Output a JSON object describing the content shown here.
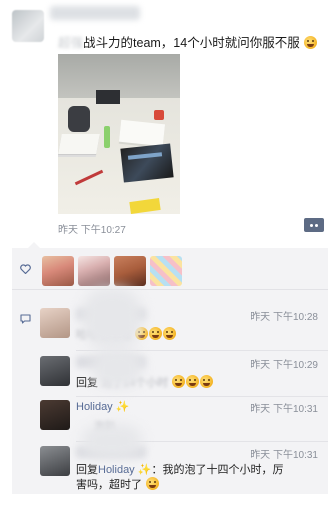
{
  "post": {
    "text_prefix": "超强",
    "text": "战斗力的team，14个小时就问你服不服",
    "time": "昨天 下午10:27"
  },
  "likes": {
    "avatars": [
      "avatar-1",
      "avatar-2",
      "avatar-3",
      "avatar-4"
    ]
  },
  "comments": [
    {
      "time": "昨天 下午10:28",
      "text_blur": "哈哈哈哈哈"
    },
    {
      "time": "昨天 下午10:29",
      "text": "回复",
      "text_blur": "泡了14个小时"
    },
    {
      "name": "Holiday",
      "sparkle": "✨",
      "time": "昨天 下午10:31",
      "text_blur": "泡趴"
    },
    {
      "time": "昨天 下午10:31",
      "reply_prefix": "回复",
      "reply_name": "Holiday",
      "sparkle": "✨",
      "line1": "：我的泡了十四个小时，厉",
      "line2": "害吗，超时了"
    }
  ],
  "colors": {
    "link_blue": "#576b95",
    "panel_bg": "#f3f3f5",
    "meta_gray": "#8a8f99"
  }
}
